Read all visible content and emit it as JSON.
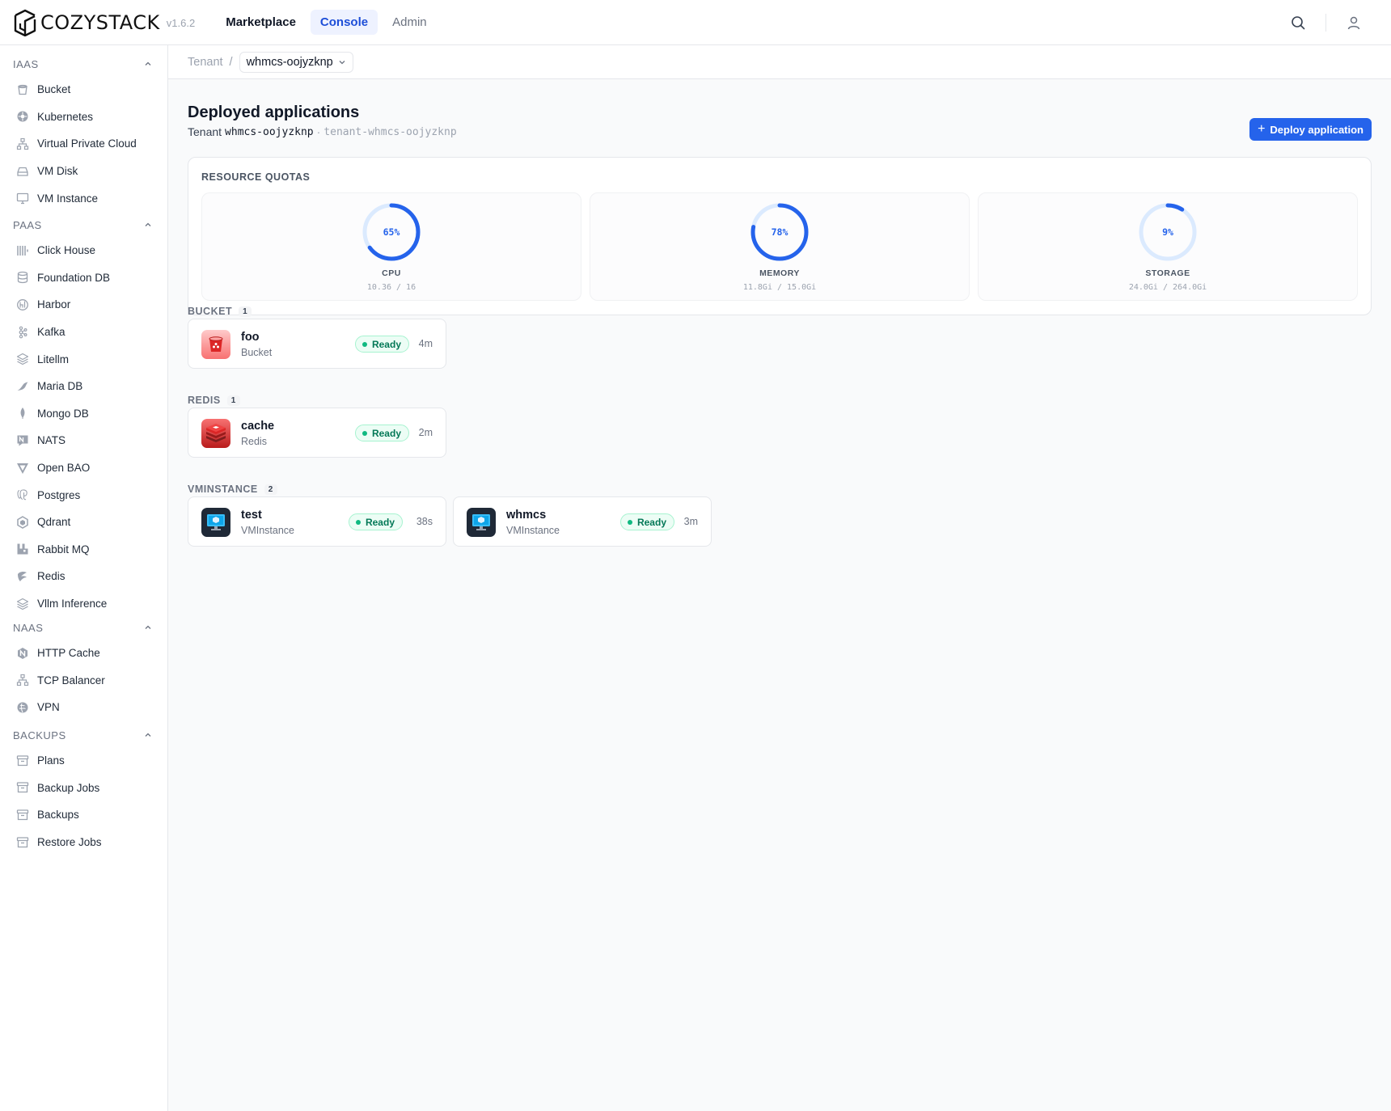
{
  "brand": {
    "name": "COZYSTACK",
    "version": "v1.6.2"
  },
  "nav": [
    {
      "label": "Marketplace"
    },
    {
      "label": "Console"
    },
    {
      "label": "Admin"
    }
  ],
  "sidebar": {
    "sections": [
      {
        "title": "IAAS",
        "items": [
          {
            "label": "Bucket",
            "icon": "bucket-icon"
          },
          {
            "label": "Kubernetes",
            "icon": "kubernetes-icon"
          },
          {
            "label": "Virtual Private Cloud",
            "icon": "network-icon"
          },
          {
            "label": "VM Disk",
            "icon": "disk-icon"
          },
          {
            "label": "VM Instance",
            "icon": "monitor-icon"
          }
        ]
      },
      {
        "title": "PAAS",
        "items": [
          {
            "label": "Click House",
            "icon": "clickhouse-icon"
          },
          {
            "label": "Foundation DB",
            "icon": "database-icon"
          },
          {
            "label": "Harbor",
            "icon": "harbor-icon"
          },
          {
            "label": "Kafka",
            "icon": "kafka-icon"
          },
          {
            "label": "Litellm",
            "icon": "layers-icon"
          },
          {
            "label": "Maria DB",
            "icon": "mariadb-icon"
          },
          {
            "label": "Mongo DB",
            "icon": "mongodb-icon"
          },
          {
            "label": "NATS",
            "icon": "nats-icon"
          },
          {
            "label": "Open BAO",
            "icon": "openbao-icon"
          },
          {
            "label": "Postgres",
            "icon": "postgres-icon"
          },
          {
            "label": "Qdrant",
            "icon": "qdrant-icon"
          },
          {
            "label": "Rabbit MQ",
            "icon": "rabbitmq-icon"
          },
          {
            "label": "Redis",
            "icon": "redis-icon"
          },
          {
            "label": "Vllm Inference",
            "icon": "layers-icon"
          }
        ]
      },
      {
        "title": "NAAS",
        "items": [
          {
            "label": "HTTP Cache",
            "icon": "nginx-icon"
          },
          {
            "label": "TCP Balancer",
            "icon": "network-icon"
          },
          {
            "label": "VPN",
            "icon": "vpn-icon"
          }
        ]
      },
      {
        "title": "BACKUPS",
        "items": [
          {
            "label": "Plans",
            "icon": "archive-icon"
          },
          {
            "label": "Backup Jobs",
            "icon": "archive-icon"
          },
          {
            "label": "Backups",
            "icon": "archive-icon"
          },
          {
            "label": "Restore Jobs",
            "icon": "archive-icon"
          }
        ]
      }
    ]
  },
  "breadcrumb": {
    "root": "Tenant",
    "separator": "/",
    "current": "whmcs-oojyzknp"
  },
  "header": {
    "title": "Deployed applications",
    "tenant_prefix": "Tenant",
    "tenant_name": "whmcs-oojyzknp",
    "separator": "·",
    "namespace": "tenant-whmcs-oojyzknp",
    "deploy_label": "Deploy application"
  },
  "quotas": {
    "title": "RESOURCE QUOTAS",
    "items": [
      {
        "label": "CPU",
        "percent": 65,
        "percent_text": "65%",
        "value": "10.36 / 16"
      },
      {
        "label": "MEMORY",
        "percent": 78,
        "percent_text": "78%",
        "value": "11.8Gi / 15.0Gi"
      },
      {
        "label": "STORAGE",
        "percent": 9,
        "percent_text": "9%",
        "value": "24.0Gi / 264.0Gi"
      }
    ]
  },
  "groups": [
    {
      "title": "BUCKET",
      "count": "1",
      "apps": [
        {
          "name": "foo",
          "kind": "Bucket",
          "status": "Ready",
          "age": "4m",
          "icon": "bucket-app-icon"
        }
      ]
    },
    {
      "title": "REDIS",
      "count": "1",
      "apps": [
        {
          "name": "cache",
          "kind": "Redis",
          "status": "Ready",
          "age": "2m",
          "icon": "redis-app-icon"
        }
      ]
    },
    {
      "title": "VMINSTANCE",
      "count": "2",
      "apps": [
        {
          "name": "test",
          "kind": "VMInstance",
          "status": "Ready",
          "age": "38s",
          "icon": "vm-app-icon"
        },
        {
          "name": "whmcs",
          "kind": "VMInstance",
          "status": "Ready",
          "age": "3m",
          "icon": "vm-app-icon"
        }
      ]
    }
  ],
  "colors": {
    "accent": "#2563eb",
    "ready": "#10b981",
    "ring_track": "#dbeafe"
  }
}
